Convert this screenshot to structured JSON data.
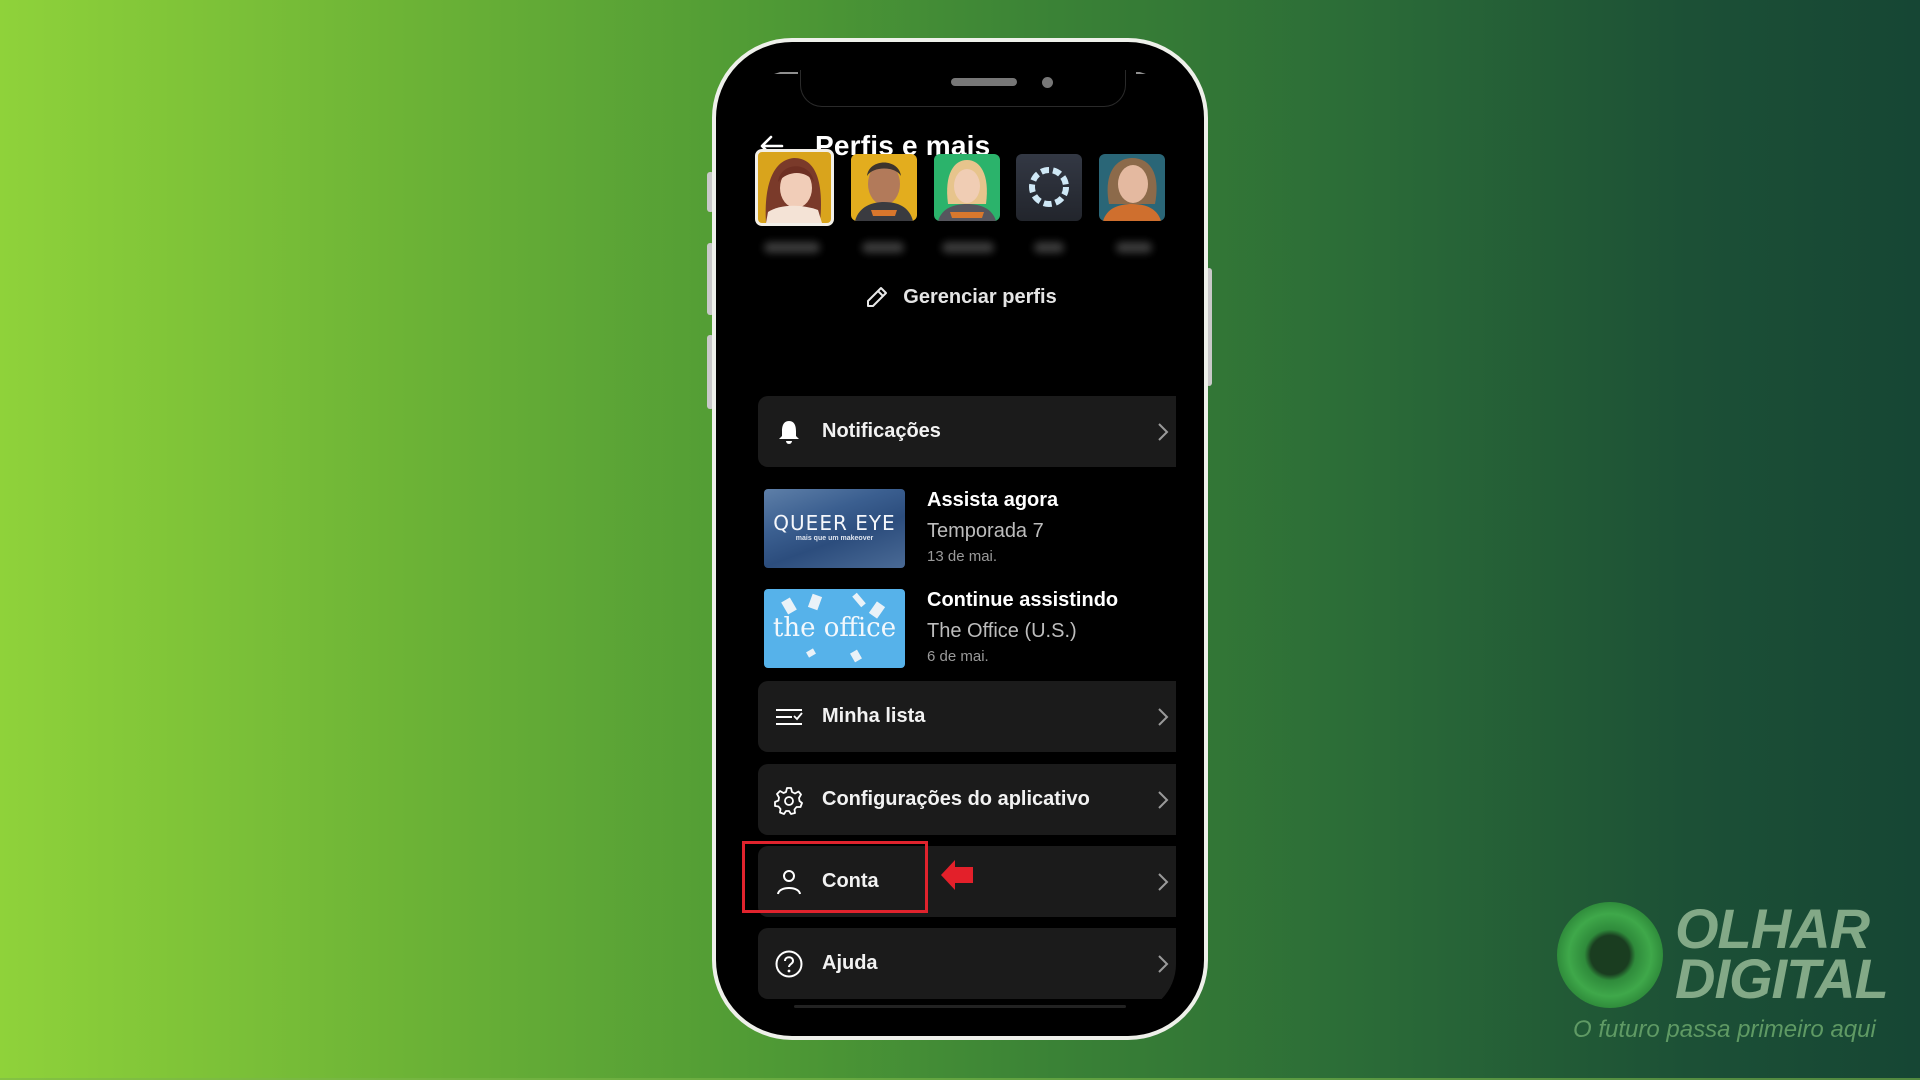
{
  "header": {
    "title": "Perfis e mais"
  },
  "profiles": [
    {
      "name_blurred": true,
      "selected": true,
      "bg": "#d9a41c"
    },
    {
      "name_blurred": true,
      "selected": false,
      "bg": "#e3ad1e"
    },
    {
      "name_blurred": true,
      "selected": false,
      "bg": "#2bb36b"
    },
    {
      "name_blurred": true,
      "selected": false,
      "bg": "#2c313c"
    },
    {
      "name_blurred": true,
      "selected": false,
      "bg": "#2a6677"
    }
  ],
  "manage_profiles": {
    "label": "Gerenciar perfis",
    "icon": "pencil-icon"
  },
  "menu": {
    "notifications": {
      "label": "Notificações",
      "icon": "bell-icon"
    },
    "my_list": {
      "label": "Minha lista",
      "icon": "list-check-icon"
    },
    "app_settings": {
      "label": "Configurações do aplicativo",
      "icon": "gear-icon"
    },
    "account": {
      "label": "Conta",
      "icon": "person-icon"
    },
    "help": {
      "label": "Ajuda",
      "icon": "question-circle-icon"
    }
  },
  "notifications": [
    {
      "title": "Assista agora",
      "subtitle": "Temporada 7",
      "date": "13 de mai.",
      "thumb_title": "QUEER EYE",
      "thumb_subtitle": "mais que um makeover"
    },
    {
      "title": "Continue assistindo",
      "subtitle": "The Office (U.S.)",
      "date": "6 de mai.",
      "thumb_title": "the office"
    }
  ],
  "annotation": {
    "highlight_color": "#e0232d",
    "target": "Conta"
  },
  "watermark": {
    "brand_line1": "OLHAR",
    "brand_line2": "DIGITAL",
    "tagline": "O futuro passa primeiro aqui"
  }
}
